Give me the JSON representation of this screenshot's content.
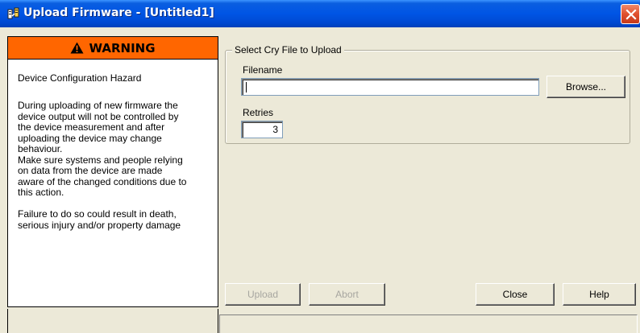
{
  "window": {
    "title": "Upload Firmware - [Untitled1]",
    "icons": {
      "app": "firmware-app-icon",
      "close": "close-icon"
    },
    "colors": {
      "titlebar": "#0055e5",
      "close_button": "#e0502e",
      "warning_banner": "#ff6600",
      "background": "#ece9d8"
    }
  },
  "warning": {
    "banner_label": "WARNING",
    "icon": "warning-triangle-icon",
    "hazard_title": "Device Configuration Hazard",
    "body": "During uploading of new firmware the\ndevice output will not be controlled by\nthe device measurement and after\nuploading the device may change\nbehaviour.\nMake sure systems and people relying\non data from the device are made\naware of the changed conditions due to\nthis action.\n\nFailure to do so could result in death,\nserious injury and/or property damage"
  },
  "upload_group": {
    "legend": "Select Cry File to Upload",
    "filename_label": "Filename",
    "filename_value": "",
    "browse_label": "Browse...",
    "retries_label": "Retries",
    "retries_value": "3"
  },
  "buttons": {
    "upload_label": "Upload",
    "abort_label": "Abort",
    "close_label": "Close",
    "help_label": "Help"
  },
  "status": {
    "text": ""
  }
}
